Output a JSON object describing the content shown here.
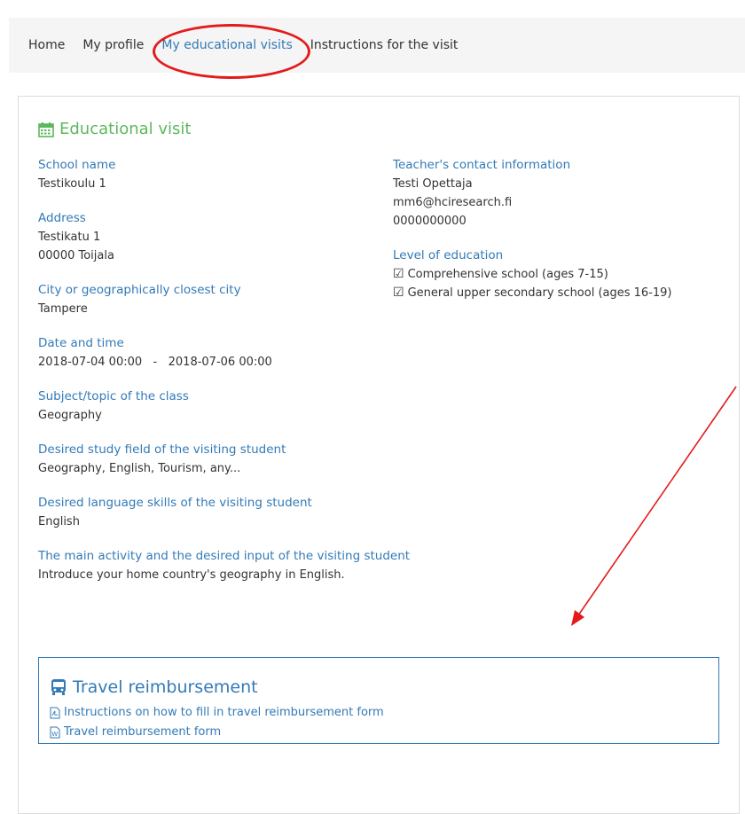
{
  "breadcrumb": {
    "items": [
      "Home",
      "My profile",
      "My educational visits",
      "Instructions for the visit"
    ]
  },
  "panel": {
    "title": "Educational visit",
    "left": [
      {
        "label": "School name",
        "values": [
          "Testikoulu 1"
        ]
      },
      {
        "label": "Address",
        "values": [
          "Testikatu 1",
          "00000 Toijala"
        ]
      },
      {
        "label": "City or geographically closest city",
        "values": [
          "Tampere"
        ]
      },
      {
        "label": "Date and time",
        "values": [
          "2018-07-04 00:00   -   2018-07-06 00:00"
        ]
      },
      {
        "label": "Subject/topic of the class",
        "values": [
          "Geography"
        ]
      },
      {
        "label": "Desired study field of the visiting student",
        "values": [
          "Geography, English, Tourism, any..."
        ]
      },
      {
        "label": "Desired language skills of the visiting student",
        "values": [
          "English"
        ]
      },
      {
        "label": "The main activity and the desired input of the visiting student",
        "values": [
          "Introduce your home country's geography in English."
        ]
      }
    ],
    "teacher": {
      "label": "Teacher's contact information",
      "values": [
        "Testi Opettaja",
        "mm6@hciresearch.fi",
        "0000000000"
      ]
    },
    "level": {
      "label": "Level of education",
      "items": [
        "Comprehensive school (ages 7-15)",
        "General upper secondary school (ages 16-19)"
      ]
    }
  },
  "travel": {
    "title": "Travel reimbursement",
    "links": [
      "Instructions on how to fill in travel reimbursement form",
      "Travel reimbursement form"
    ]
  },
  "icons": {
    "title": "calendar-icon",
    "travel": "bus-icon",
    "pdf": "pdf-file-icon",
    "word": "word-file-icon",
    "check": "checkbox-checked-icon"
  },
  "colors": {
    "label": "#337ab7",
    "title": "#5cb85c",
    "annotation": "#e31b1b"
  }
}
